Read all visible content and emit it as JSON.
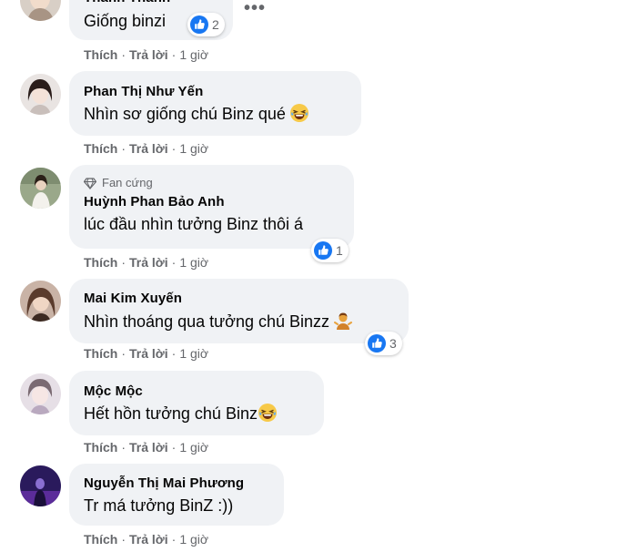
{
  "comments": [
    {
      "author": "Thanh Thanh",
      "text": "Giống binzi",
      "reaction_count": "2",
      "like_label": "Thích",
      "reply_label": "Trả lời",
      "time": "1 giờ"
    },
    {
      "author": "Phan Thị Như Yến",
      "text": "Nhìn sơ giống chú Binz qué",
      "emoji": "laughing-crying-emoji",
      "like_label": "Thích",
      "reply_label": "Trả lời",
      "time": "1 giờ"
    },
    {
      "badge": "Fan cứng",
      "author": "Huỳnh Phan Bảo Anh",
      "text": "lúc đầu nhìn tưởng Binz thôi á",
      "reaction_count": "1",
      "like_label": "Thích",
      "reply_label": "Trả lời",
      "time": "1 giờ"
    },
    {
      "author": "Mai Kim Xuyến",
      "text": "Nhìn thoáng qua tưởng chú Binzz",
      "emoji": "shrug-emoji",
      "reaction_count": "3",
      "like_label": "Thích",
      "reply_label": "Trả lời",
      "time": "1 giờ"
    },
    {
      "author": "Mộc Mộc",
      "text": "Hết hồn tưởng chú Binz",
      "emoji": "laughing-crying-emoji",
      "like_label": "Thích",
      "reply_label": "Trả lời",
      "time": "1 giờ"
    },
    {
      "author": "Nguyễn Thị Mai Phương",
      "text": "Tr má tưởng BinZ :))",
      "like_label": "Thích",
      "reply_label": "Trả lời",
      "time": "1 giờ"
    }
  ],
  "more_options": "•••",
  "separator": "·",
  "colors": {
    "bubble": "#f0f2f5",
    "like_blue": "#1877f2",
    "secondary_text": "#65676b"
  }
}
